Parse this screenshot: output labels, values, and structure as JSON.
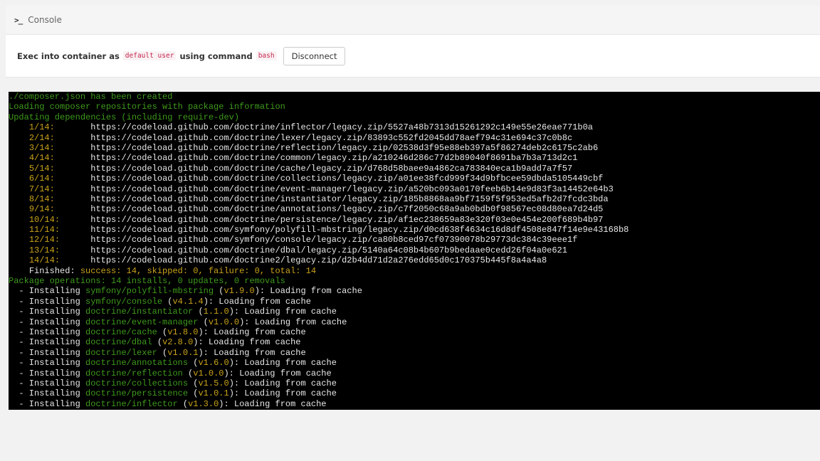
{
  "header": {
    "title": "Console",
    "icon": "terminal-prompt-icon"
  },
  "exec_bar": {
    "prefix": "Exec into container as",
    "user": "default user",
    "middle": "using command",
    "command": "bash",
    "disconnect_label": "Disconnect"
  },
  "colors": {
    "green": "#3e9a1c",
    "yellow": "#c9a21a",
    "white": "#e8e8e8",
    "terminal_bg": "#000000"
  },
  "terminal": {
    "intro": [
      "./composer.json has been created",
      "Loading composer repositories with package information",
      "Updating dependencies (including require-dev)"
    ],
    "downloads": [
      {
        "n": "1/14:",
        "url": "https://codeload.github.com/doctrine/inflector/legacy.zip/5527a48b7313d15261292c149e55e26eae771b0a"
      },
      {
        "n": "2/14:",
        "url": "https://codeload.github.com/doctrine/lexer/legacy.zip/83893c552fd2045dd78aef794c31e694c37c0b8c"
      },
      {
        "n": "3/14:",
        "url": "https://codeload.github.com/doctrine/reflection/legacy.zip/02538d3f95e88eb397a5f86274deb2c6175c2ab6"
      },
      {
        "n": "4/14:",
        "url": "https://codeload.github.com/doctrine/common/legacy.zip/a210246d286c77d2b89040f8691ba7b3a713d2c1"
      },
      {
        "n": "5/14:",
        "url": "https://codeload.github.com/doctrine/cache/legacy.zip/d768d58baee9a4862ca783840eca1b9add7a7f57"
      },
      {
        "n": "6/14:",
        "url": "https://codeload.github.com/doctrine/collections/legacy.zip/a01ee38fcd999f34d9bfbcee59dbda5105449cbf"
      },
      {
        "n": "7/14:",
        "url": "https://codeload.github.com/doctrine/event-manager/legacy.zip/a520bc093a0170feeb6b14e9d83f3a14452e64b3"
      },
      {
        "n": "8/14:",
        "url": "https://codeload.github.com/doctrine/instantiator/legacy.zip/185b8868aa9bf7159f5f953ed5afb2d7fcdc3bda"
      },
      {
        "n": "9/14:",
        "url": "https://codeload.github.com/doctrine/annotations/legacy.zip/c7f2050c68a9ab0bdb0f98567ec08d80ea7d24d5"
      },
      {
        "n": "10/14:",
        "url": "https://codeload.github.com/doctrine/persistence/legacy.zip/af1ec238659a83e320f03e0e454e200f689b4b97"
      },
      {
        "n": "11/14:",
        "url": "https://codeload.github.com/symfony/polyfill-mbstring/legacy.zip/d0cd638f4634c16d8df4508e847f14e9e43168b8"
      },
      {
        "n": "12/14:",
        "url": "https://codeload.github.com/symfony/console/legacy.zip/ca80b8ced97cf07390078b29773dc384c39eee1f"
      },
      {
        "n": "13/14:",
        "url": "https://codeload.github.com/doctrine/dbal/legacy.zip/5140a64c08b4b607b9bedaae0cedd26f04a0e621"
      },
      {
        "n": "14/14:",
        "url": "https://codeload.github.com/doctrine2/legacy.zip/d2b4dd71d2a276edd65d0c170375b445f8a4a4a8"
      }
    ],
    "finished_label": "Finished:",
    "finished_stats": "success: 14, skipped: 0, failure: 0, total: 14",
    "package_ops": "Package operations: 14 installs, 0 updates, 0 removals",
    "install_prefix": "  - Installing ",
    "install_suffix": ": Loading from cache",
    "installs": [
      {
        "pkg": "symfony/polyfill-mbstring",
        "ver": "v1.9.0"
      },
      {
        "pkg": "symfony/console",
        "ver": "v4.1.4"
      },
      {
        "pkg": "doctrine/instantiator",
        "ver": "1.1.0"
      },
      {
        "pkg": "doctrine/event-manager",
        "ver": "v1.0.0"
      },
      {
        "pkg": "doctrine/cache",
        "ver": "v1.8.0"
      },
      {
        "pkg": "doctrine/dbal",
        "ver": "v2.8.0"
      },
      {
        "pkg": "doctrine/lexer",
        "ver": "v1.0.1"
      },
      {
        "pkg": "doctrine/annotations",
        "ver": "v1.6.0"
      },
      {
        "pkg": "doctrine/reflection",
        "ver": "v1.0.0"
      },
      {
        "pkg": "doctrine/collections",
        "ver": "v1.5.0"
      },
      {
        "pkg": "doctrine/persistence",
        "ver": "v1.0.1"
      },
      {
        "pkg": "doctrine/inflector",
        "ver": "v1.3.0"
      }
    ]
  }
}
